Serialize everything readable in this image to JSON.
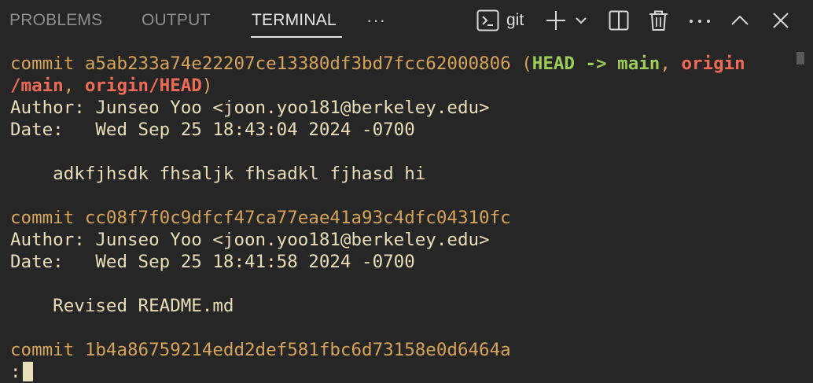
{
  "tabs": [
    {
      "label": "PROBLEMS"
    },
    {
      "label": "OUTPUT"
    },
    {
      "label": "TERMINAL"
    }
  ],
  "more_tabs": "···",
  "toolbar": {
    "shell_label": "git",
    "icons": [
      "terminal-icon",
      "plus-icon",
      "chevron-down-icon",
      "split-icon",
      "trash-icon",
      "more-icon",
      "chevron-up-icon",
      "close-icon"
    ]
  },
  "terminal": {
    "commit1": {
      "prefix": "commit ",
      "hash": "a5ab233a74e22207ce13380df3bd7fcc62000806",
      "open": " (",
      "head": "HEAD -> main",
      "sep1": ", ",
      "origin": "origin",
      "wrap": "/main",
      "sep2": ", ",
      "origin_head": "origin/HEAD",
      "close": ")",
      "author": "Author: Junseo Yoo <joon.yoo181@berkeley.edu>",
      "date": "Date:   Wed Sep 25 18:43:04 2024 -0700",
      "message": "    adkfjhsdk fhsaljk fhsadkl fjhasd hi"
    },
    "commit2": {
      "line": "commit cc08f7f0c9dfcf47ca77eae41a93c4dfc04310fc",
      "author": "Author: Junseo Yoo <joon.yoo181@berkeley.edu>",
      "date": "Date:   Wed Sep 25 18:41:58 2024 -0700",
      "message": "    Revised README.md"
    },
    "commit3": {
      "line": "commit 1b4a86759214edd2def581fbc6d73158e0d6464a"
    },
    "prompt": ":"
  }
}
